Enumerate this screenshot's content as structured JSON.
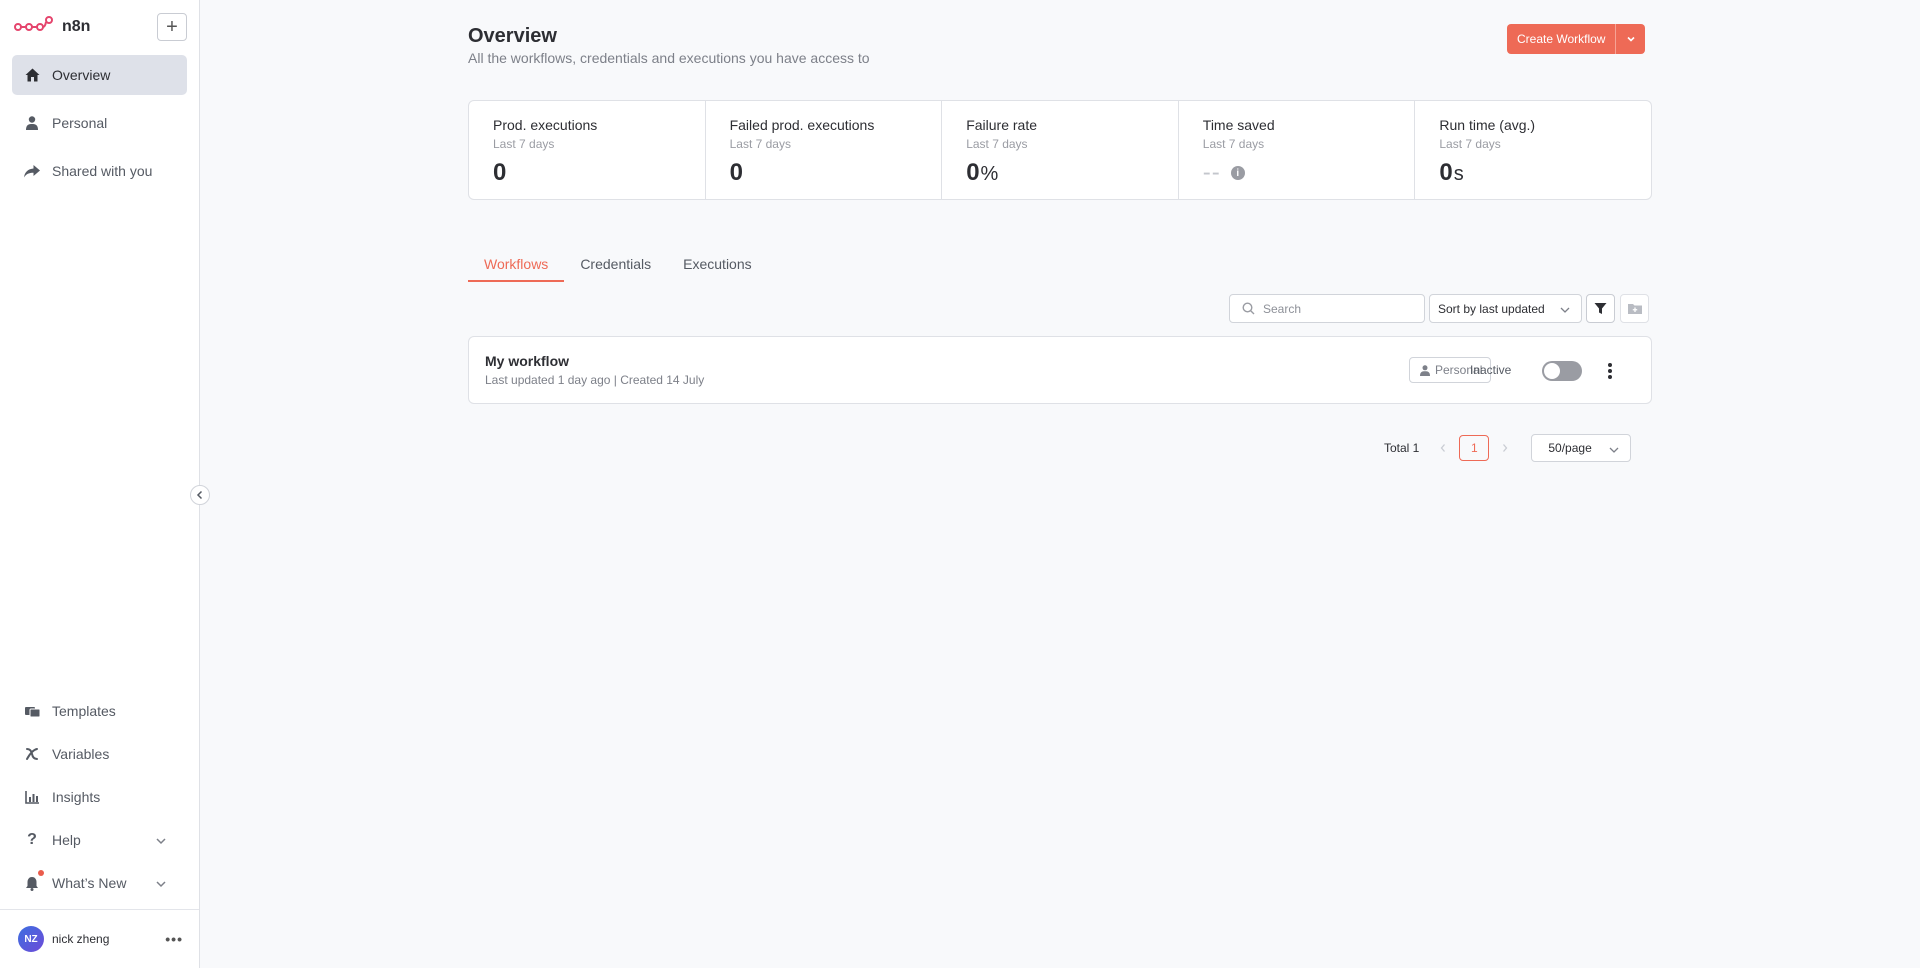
{
  "brand": {
    "name": "n8n",
    "add_label": "+"
  },
  "sidebar": {
    "top_items": [
      {
        "label": "Overview",
        "icon": "home-icon",
        "active": true
      },
      {
        "label": "Personal",
        "icon": "user-icon"
      },
      {
        "label": "Shared with you",
        "icon": "share-icon"
      }
    ],
    "bottom_items": [
      {
        "label": "Templates",
        "icon": "templates-icon"
      },
      {
        "label": "Variables",
        "icon": "variables-icon"
      },
      {
        "label": "Insights",
        "icon": "insights-icon"
      },
      {
        "label": "Help",
        "icon": "help-icon"
      },
      {
        "label": "What’s New",
        "icon": "bell-icon"
      }
    ],
    "user": {
      "initials": "NZ",
      "name": "nick zheng",
      "menu": "•••"
    }
  },
  "header": {
    "title": "Overview",
    "subtitle": "All the workflows, credentials and executions you have access to",
    "create_label": "Create Workflow"
  },
  "stats": [
    {
      "label": "Prod. executions",
      "period": "Last 7 days",
      "value": "0",
      "unit": ""
    },
    {
      "label": "Failed prod. executions",
      "period": "Last 7 days",
      "value": "0",
      "unit": ""
    },
    {
      "label": "Failure rate",
      "period": "Last 7 days",
      "value": "0",
      "unit": "%"
    },
    {
      "label": "Time saved",
      "period": "Last 7 days",
      "value": "--",
      "unit": ""
    },
    {
      "label": "Run time (avg.)",
      "period": "Last 7 days",
      "value": "0",
      "unit": "s"
    }
  ],
  "tabs": [
    {
      "label": "Workflows",
      "active": true
    },
    {
      "label": "Credentials"
    },
    {
      "label": "Executions"
    }
  ],
  "toolbar": {
    "search_placeholder": "Search",
    "sort_label": "Sort by last updated"
  },
  "workflow": {
    "name": "My workflow",
    "meta": "Last updated 1 day ago | Created 14 July",
    "badge": "Personal",
    "status": "Inactive"
  },
  "pagination": {
    "total": "Total 1",
    "current_page": "1",
    "page_size": "50/page"
  },
  "colors": {
    "accent": "#ee6a56",
    "brand": "#e5456d",
    "toggle_off": "#9a9ca3"
  }
}
